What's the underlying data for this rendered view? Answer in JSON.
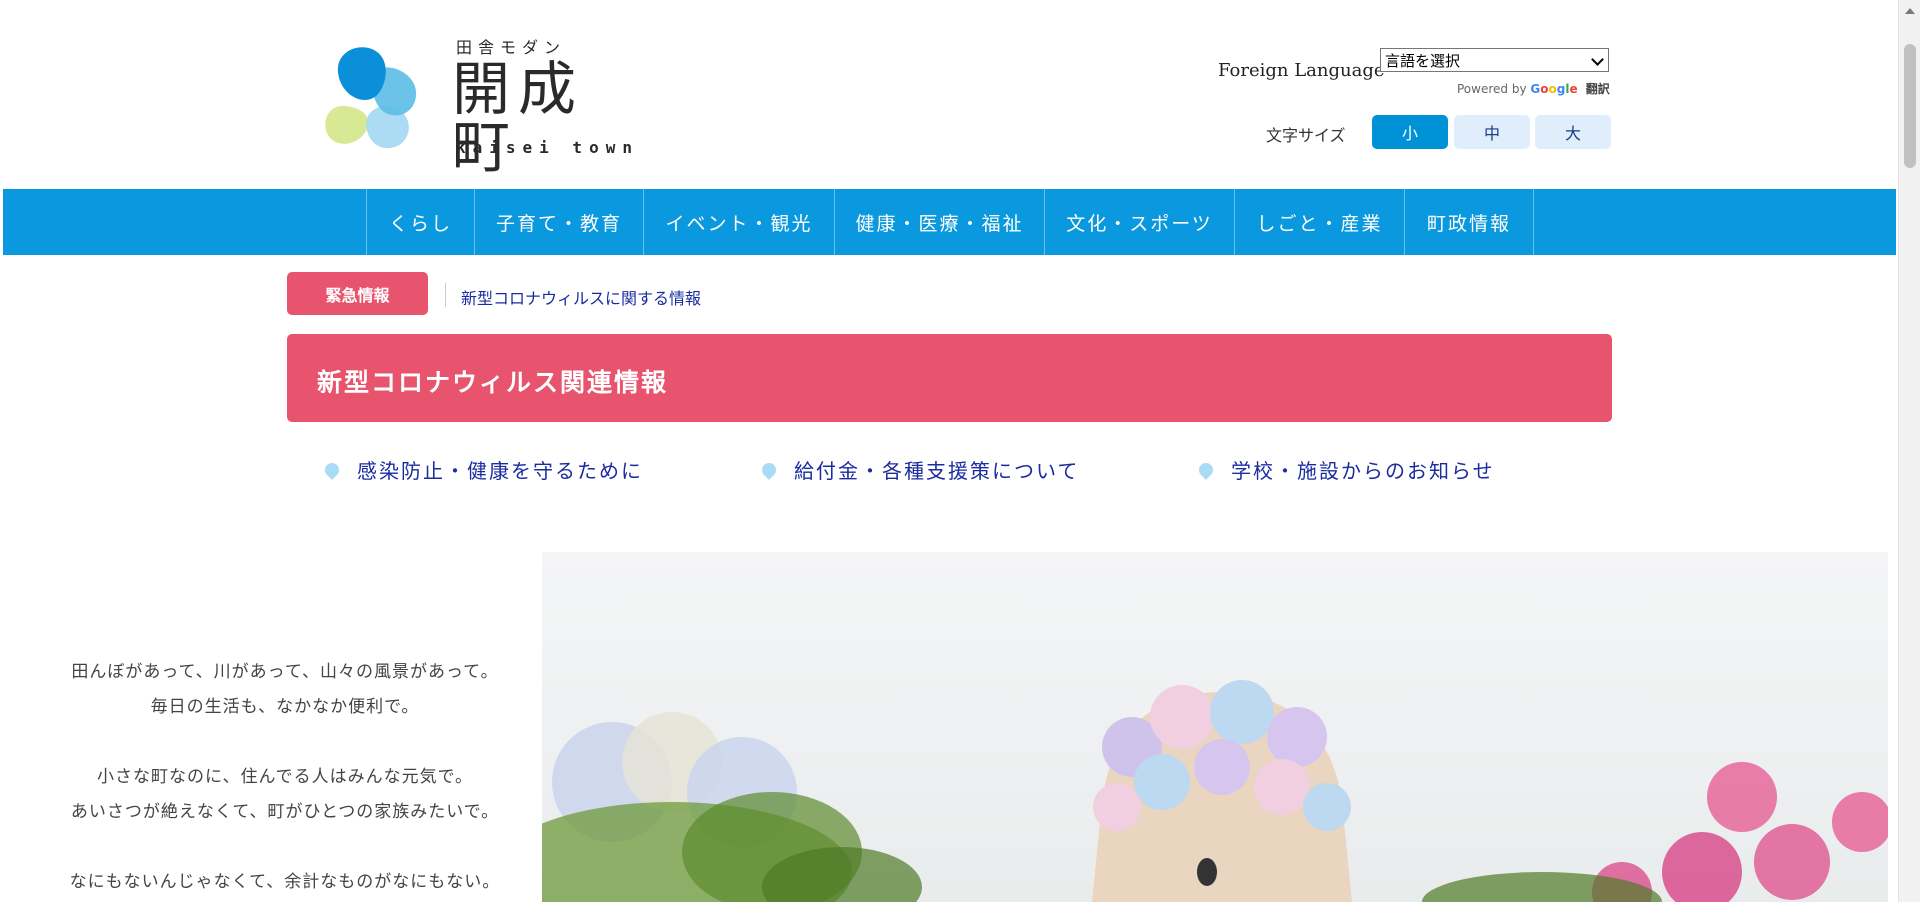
{
  "header": {
    "logo": {
      "tagline": "田舎モダン",
      "name": "開成町",
      "roman": "kaisei town"
    },
    "language": {
      "label": "Foreign Language",
      "select_value": "言語を選択",
      "powered_by": "Powered by",
      "google": "Google",
      "translate": "翻訳"
    },
    "font_size": {
      "label": "文字サイズ",
      "small": "小",
      "medium": "中",
      "large": "大",
      "selected": "小"
    }
  },
  "nav": {
    "items": [
      "くらし",
      "子育て・教育",
      "イベント・観光",
      "健康・医療・福祉",
      "文化・スポーツ",
      "しごと・産業",
      "町政情報"
    ]
  },
  "emergency": {
    "button": "緊急情報",
    "link": "新型コロナウィルスに関する情報"
  },
  "covid": {
    "title": "新型コロナウィルス関連情報",
    "links": [
      "感染防止・健康を守るために",
      "給付金・各種支援策について",
      "学校・施設からのお知らせ"
    ]
  },
  "hero": {
    "paragraphs": [
      [
        "田んぼがあって、川があって、山々の風景があって。",
        "毎日の生活も、なかなか便利で。"
      ],
      [
        "小さな町なのに、住んでる人はみんな元気で。",
        "あいさつが絶えなくて、町がひとつの家族みたいで。"
      ],
      [
        "なにもないんじゃなくて、余計なものがなにもない。"
      ]
    ]
  },
  "colors": {
    "nav_blue": "#0a98de",
    "emergency_pink": "#e8546d",
    "link_blue": "#1a2ca0",
    "fontsize_active": "#0092d6",
    "fontsize_inactive": "#dfeefa"
  }
}
